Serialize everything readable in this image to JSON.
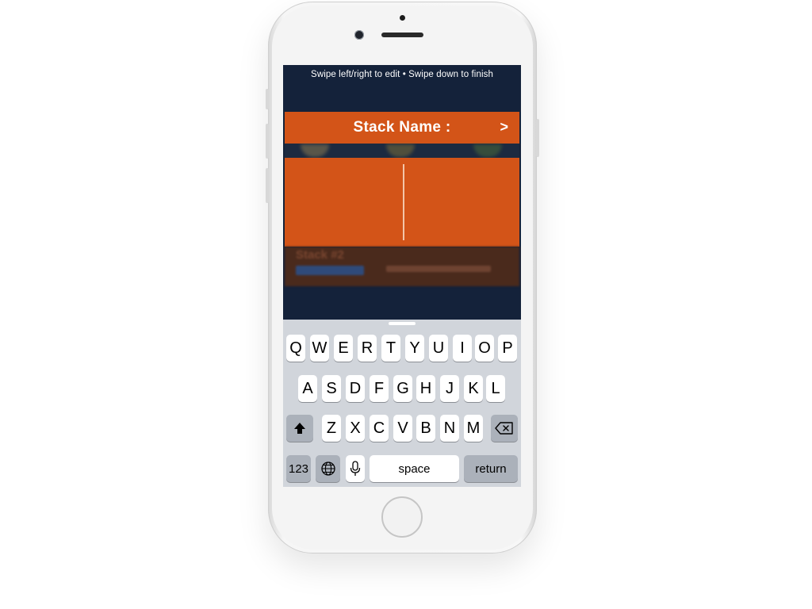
{
  "screen": {
    "hint": "Swipe left/right to edit • Swipe down to finish",
    "stack_header": {
      "title": "Stack Name :",
      "chevron": ">"
    },
    "edit_field": {
      "value": ""
    },
    "blurred_stack": {
      "name": "Stack #2"
    }
  },
  "keyboard": {
    "row1": [
      "Q",
      "W",
      "E",
      "R",
      "T",
      "Y",
      "U",
      "I",
      "O",
      "P"
    ],
    "row2": [
      "A",
      "S",
      "D",
      "F",
      "G",
      "H",
      "J",
      "K",
      "L"
    ],
    "row3": [
      "Z",
      "X",
      "C",
      "V",
      "B",
      "N",
      "M"
    ],
    "numbers_label": "123",
    "space_label": "space",
    "return_label": "return"
  },
  "colors": {
    "accent": "#d35418",
    "screen_bg": "#14223a",
    "keyboard_bg": "#d1d5db"
  },
  "icons": [
    "shift-icon",
    "backspace-icon",
    "globe-icon",
    "microphone-icon",
    "chevron-right-icon"
  ]
}
